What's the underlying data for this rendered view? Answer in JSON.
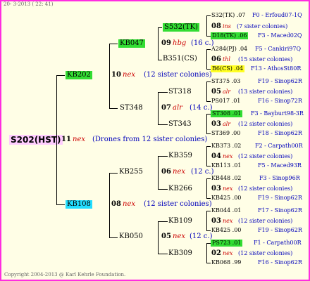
{
  "header": "20- 3-2013 ( 22: 41)",
  "footer": "Copyright 2004-2013 @ Karl Kehrle Foundation.",
  "root": {
    "id": "S202(HST)",
    "gen": "11",
    "mark": "nex",
    "note": "(Drones from 12 sister colonies)"
  },
  "level1": [
    {
      "id": "KB202",
      "gen": "10",
      "mark": "nex",
      "note": "(12 sister colonies)"
    },
    {
      "id": "KB108",
      "gen": "08",
      "mark": "nex",
      "note": "(12 sister colonies)"
    }
  ],
  "level2": [
    {
      "id": "KB047",
      "gen": "09",
      "mark": "hbg",
      "note": "(16 c.)"
    },
    {
      "id": "ST348",
      "gen": "07",
      "mark": "alr",
      "note": "(14 c.)"
    },
    {
      "id": "KB255",
      "gen": "06",
      "mark": "nex",
      "note": "(12 c.)"
    },
    {
      "id": "KB050",
      "gen": "05",
      "mark": "nex",
      "note": "(12 c.)"
    }
  ],
  "level3": [
    "S532(TK)",
    "B351(CS)",
    "ST318",
    "ST343",
    "KB359",
    "KB266",
    "KB109",
    "KB309"
  ],
  "level4": [
    {
      "top": "S32(TK) .07",
      "top_info": "F0 - Erfoud07-1Q",
      "gen": "08",
      "mark": "ins",
      "note": "(7 sister colonies)",
      "bottom": "D18(TK) .06",
      "bottom_info": "F3 - Maced02Q"
    },
    {
      "top": "A284(PJ) .04",
      "top_info": "F5 - Cankiri97Q",
      "gen": "06",
      "mark": "thl",
      "note": "(15 sister colonies)",
      "bottom": "B6(CS) .04",
      "bottom_info": "F13 - AthosSt80R"
    },
    {
      "top": "ST375 .03",
      "top_info": "F19 - Sinop62R",
      "gen": "05",
      "mark": "alr",
      "note": "(13 sister colonies)",
      "bottom": "PS017 .01",
      "bottom_info": "F16 - Sinop72R"
    },
    {
      "top": "ST308 .01",
      "top_info": "F3 - Bayburt98-3R",
      "gen": "03",
      "mark": "alr",
      "note": "(12 sister colonies)",
      "bottom": "ST369 .00",
      "bottom_info": "F18 - Sinop62R"
    },
    {
      "top": "KB373 .02",
      "top_info": "F2 - Carpath00R",
      "gen": "04",
      "mark": "nex",
      "note": "(12 sister colonies)",
      "bottom": "KB113 .01",
      "bottom_info": "F5 - Maced93R"
    },
    {
      "top": "KB448 .02",
      "top_info": "F3 - Sinop96R",
      "gen": "03",
      "mark": "nex",
      "note": "(12 sister colonies)",
      "bottom": "KB425 .00",
      "bottom_info": "F19 - Sinop62R"
    },
    {
      "top": "KB044 .01",
      "top_info": "F17 - Sinop62R",
      "gen": "03",
      "mark": "nex",
      "note": "(12 sister colonies)",
      "bottom": "KB425 .00",
      "bottom_info": "F19 - Sinop62R"
    },
    {
      "top": "PS723 .01",
      "top_info": "F1 - Carpath00R",
      "gen": "02",
      "mark": "nex",
      "note": "(12 sister colonies)",
      "bottom": "KB068 .99",
      "bottom_info": "F16 - Sinop62R"
    }
  ]
}
